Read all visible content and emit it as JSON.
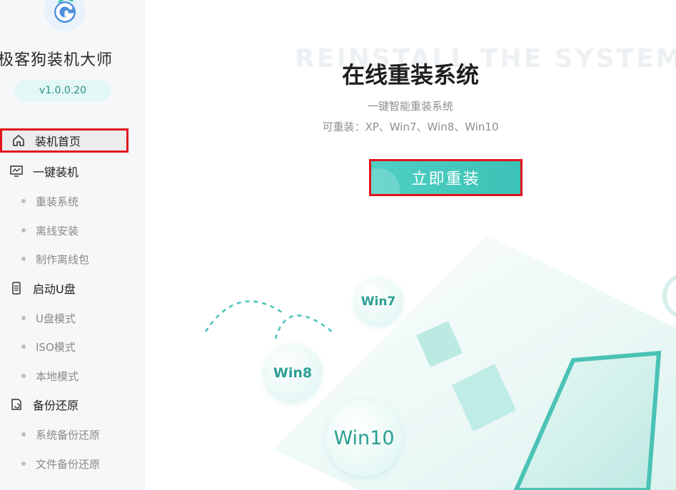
{
  "app": {
    "name": "极客狗装机大师",
    "version": "v1.0.0.20"
  },
  "sidebar": {
    "items": [
      {
        "label": "装机首页",
        "icon": "home-icon",
        "active": true
      },
      {
        "label": "一键装机",
        "icon": "monitor-icon"
      },
      {
        "label": "重装系统",
        "sub": true
      },
      {
        "label": "离线安装",
        "sub": true
      },
      {
        "label": "制作离线包",
        "sub": true
      },
      {
        "label": "启动U盘",
        "icon": "usb-drive-icon"
      },
      {
        "label": "U盘模式",
        "sub": true
      },
      {
        "label": "ISO模式",
        "sub": true
      },
      {
        "label": "本地模式",
        "sub": true
      },
      {
        "label": "备份还原",
        "icon": "backup-icon"
      },
      {
        "label": "系统备份还原",
        "sub": true
      },
      {
        "label": "文件备份还原",
        "sub": true
      }
    ]
  },
  "main": {
    "background_title": "REINSTALL THE SYSTEM",
    "title": "在线重装系统",
    "subtitle": "一键智能重装系统",
    "supported": "可重装：XP、Win7、Win8、Win10",
    "button_label": "立即重装",
    "bubbles": [
      "Win7",
      "Win8",
      "Win10"
    ]
  },
  "colors": {
    "accent": "#3cc2b6",
    "highlight_border": "#e2141c",
    "sidebar_bg": "#f5f7f8"
  }
}
